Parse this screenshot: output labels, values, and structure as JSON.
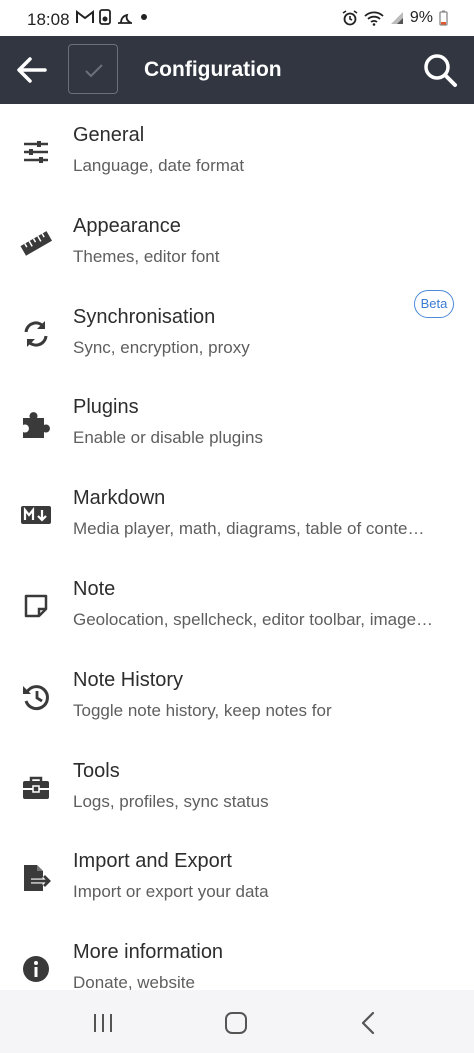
{
  "status_bar": {
    "time": "18:08",
    "battery": "9%",
    "icons": [
      "gmail-icon",
      "sim-icon",
      "dnd-moon-icon",
      "dot-icon",
      "alarm-icon",
      "wifi-icon",
      "signal-icon",
      "battery-icon"
    ]
  },
  "app_bar": {
    "title": "Configuration",
    "back_icon": "arrow-left-icon",
    "checkbox_icon": "check-icon",
    "search_icon": "search-icon",
    "background": "#313640"
  },
  "items": [
    {
      "label": "General",
      "desc": "Language, date format",
      "icon": "sliders-icon"
    },
    {
      "label": "Appearance",
      "desc": "Themes, editor font",
      "icon": "ruler-icon"
    },
    {
      "label": "Synchronisation",
      "desc": "Sync, encryption, proxy",
      "icon": "sync-icon"
    },
    {
      "label": "Plugins",
      "desc": "Enable or disable plugins",
      "icon": "puzzle-icon",
      "badge": "Beta"
    },
    {
      "label": "Markdown",
      "desc": "Media player, math, diagrams, table of conte…",
      "icon": "markdown-icon"
    },
    {
      "label": "Note",
      "desc": "Geolocation, spellcheck, editor toolbar, image…",
      "icon": "note-icon"
    },
    {
      "label": "Note History",
      "desc": "Toggle note history, keep notes for",
      "icon": "history-icon"
    },
    {
      "label": "Tools",
      "desc": "Logs, profiles, sync status",
      "icon": "toolbox-icon"
    },
    {
      "label": "Import and Export",
      "desc": "Import or export your data",
      "icon": "file-export-icon"
    },
    {
      "label": "More information",
      "desc": "Donate, website",
      "icon": "info-icon"
    }
  ],
  "nav_bar": {
    "icons": [
      "recent-apps-icon",
      "home-icon",
      "back-icon"
    ]
  }
}
